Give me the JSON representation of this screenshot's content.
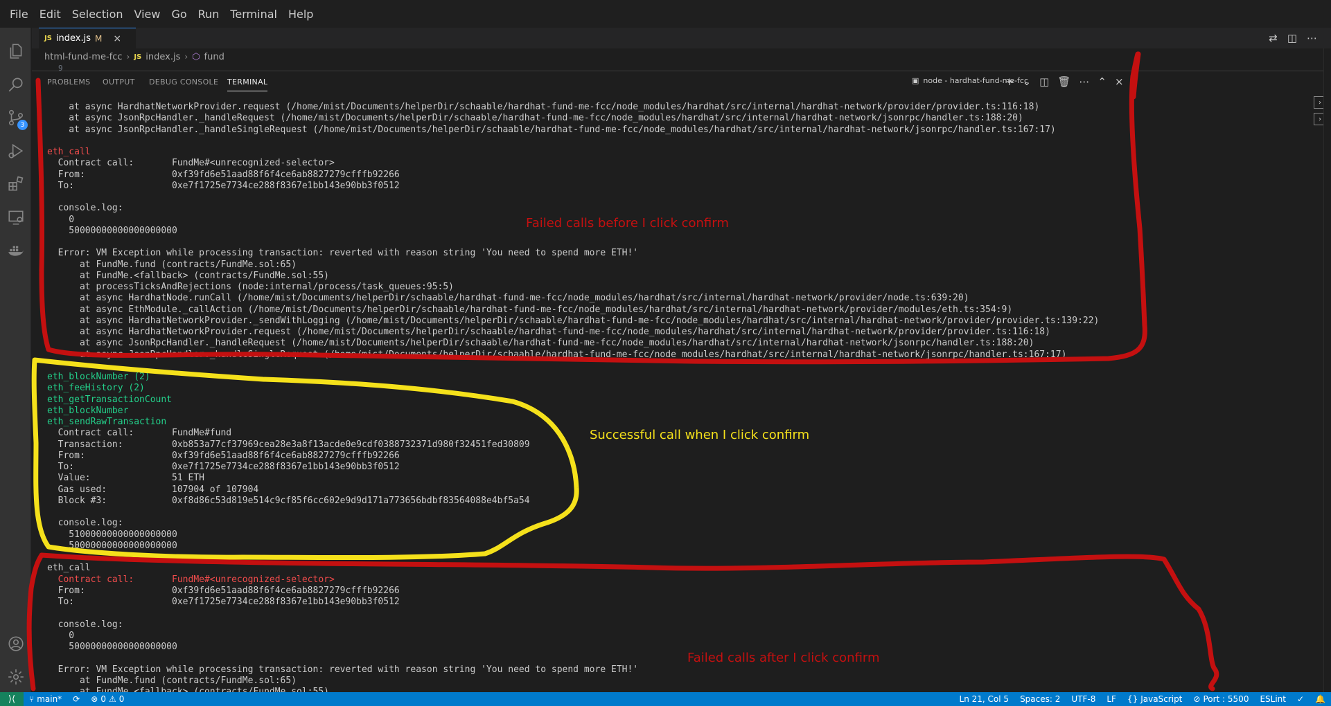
{
  "menu": [
    "File",
    "Edit",
    "Selection",
    "View",
    "Go",
    "Run",
    "Terminal",
    "Help"
  ],
  "activity": {
    "scm_badge": "3"
  },
  "editor": {
    "tab_icon": "JS",
    "tab_label": "index.js",
    "tab_modified": "M",
    "breadcrumb": {
      "folder": "html-fund-me-fcc",
      "file_icon": "JS",
      "file": "index.js",
      "symbol": "fund"
    },
    "line_number": "9"
  },
  "panel": {
    "tabs": [
      "PROBLEMS",
      "OUTPUT",
      "DEBUG CONSOLE",
      "TERMINAL"
    ],
    "active_tab": "TERMINAL",
    "terminal_name": "node - hardhat-fund-me-fcc"
  },
  "terminal_lines": [
    "    at async HardhatNetworkProvider.request (/home/mist/Documents/helperDir/schaable/hardhat-fund-me-fcc/node_modules/hardhat/src/internal/hardhat-network/provider/provider.ts:116:18)",
    "    at async JsonRpcHandler._handleRequest (/home/mist/Documents/helperDir/schaable/hardhat-fund-me-fcc/node_modules/hardhat/src/internal/hardhat-network/jsonrpc/handler.ts:188:20)",
    "    at async JsonRpcHandler._handleSingleRequest (/home/mist/Documents/helperDir/schaable/hardhat-fund-me-fcc/node_modules/hardhat/src/internal/hardhat-network/jsonrpc/handler.ts:167:17)",
    "",
    "eth_call",
    "  Contract call:       FundMe#<unrecognized-selector>",
    "  From:                0xf39fd6e51aad88f6f4ce6ab8827279cfffb92266",
    "  To:                  0xe7f1725e7734ce288f8367e1bb143e90bb3f0512",
    "",
    "  console.log:",
    "    0",
    "    50000000000000000000",
    "",
    "  Error: VM Exception while processing transaction: reverted with reason string 'You need to spend more ETH!'",
    "      at FundMe.fund (contracts/FundMe.sol:65)",
    "      at FundMe.<fallback> (contracts/FundMe.sol:55)",
    "      at processTicksAndRejections (node:internal/process/task_queues:95:5)",
    "      at async HardhatNode.runCall (/home/mist/Documents/helperDir/schaable/hardhat-fund-me-fcc/node_modules/hardhat/src/internal/hardhat-network/provider/node.ts:639:20)",
    "      at async EthModule._callAction (/home/mist/Documents/helperDir/schaable/hardhat-fund-me-fcc/node_modules/hardhat/src/internal/hardhat-network/provider/modules/eth.ts:354:9)",
    "      at async HardhatNetworkProvider._sendWithLogging (/home/mist/Documents/helperDir/schaable/hardhat-fund-me-fcc/node_modules/hardhat/src/internal/hardhat-network/provider/provider.ts:139:22)",
    "      at async HardhatNetworkProvider.request (/home/mist/Documents/helperDir/schaable/hardhat-fund-me-fcc/node_modules/hardhat/src/internal/hardhat-network/provider/provider.ts:116:18)",
    "      at async JsonRpcHandler._handleRequest (/home/mist/Documents/helperDir/schaable/hardhat-fund-me-fcc/node_modules/hardhat/src/internal/hardhat-network/jsonrpc/handler.ts:188:20)",
    "      at async JsonRpcHandler._handleSingleRequest (/home/mist/Documents/helperDir/schaable/hardhat-fund-me-fcc/node_modules/hardhat/src/internal/hardhat-network/jsonrpc/handler.ts:167:17)",
    "",
    "eth_blockNumber (2)",
    "eth_feeHistory (2)",
    "eth_getTransactionCount",
    "eth_blockNumber",
    "eth_sendRawTransaction",
    "  Contract call:       FundMe#fund",
    "  Transaction:         0xb853a77cf37969cea28e3a8f13acde0e9cdf0388732371d980f32451fed30809",
    "  From:                0xf39fd6e51aad88f6f4ce6ab8827279cfffb92266",
    "  To:                  0xe7f1725e7734ce288f8367e1bb143e90bb3f0512",
    "  Value:               51 ETH",
    "  Gas used:            107904 of 107904",
    "  Block #3:            0xf8d86c53d819e514c9cf85f6cc602e9d9d171a773656bdbf83564088e4bf5a54",
    "",
    "  console.log:",
    "    51000000000000000000",
    "    50000000000000000000",
    "",
    "eth_call",
    "  Contract call:       FundMe#<unrecognized-selector>",
    "  From:                0xf39fd6e51aad88f6f4ce6ab8827279cfffb92266",
    "  To:                  0xe7f1725e7734ce288f8367e1bb143e90bb3f0512",
    "",
    "  console.log:",
    "    0",
    "    50000000000000000000",
    "",
    "  Error: VM Exception while processing transaction: reverted with reason string 'You need to spend more ETH!'",
    "      at FundMe.fund (contracts/FundMe.sol:65)",
    "      at FundMe.<fallback> (contracts/FundMe.sol:55)"
  ],
  "red_lines": [
    4,
    42
  ],
  "green_lines": [
    24,
    25,
    26,
    27,
    28
  ],
  "annotations": {
    "failed_before": "Failed calls before I click confirm",
    "successful": "Successful call when I click confirm",
    "failed_after": "Failed calls after I click confirm",
    "red_color": "#c41010",
    "yellow_color": "#f5e11b"
  },
  "status": {
    "branch": "main*",
    "errors": "0",
    "warnings": "0",
    "position": "Ln 21, Col 5",
    "spaces": "Spaces: 2",
    "encoding": "UTF-8",
    "eol": "LF",
    "language": "JavaScript",
    "port": "Port : 5500",
    "linter": "ESLint"
  }
}
